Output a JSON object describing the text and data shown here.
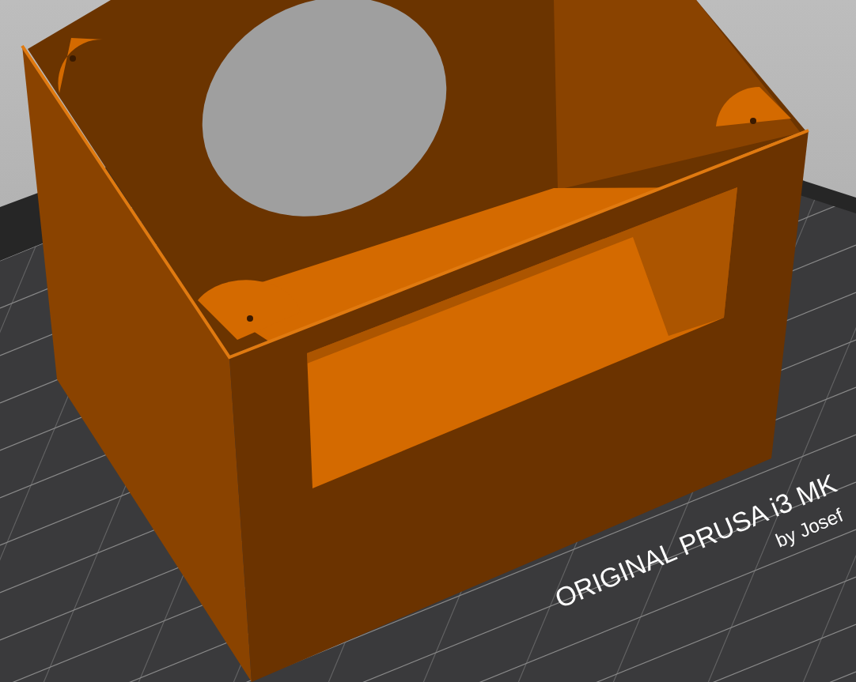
{
  "bed_label": {
    "title": "ORIGINAL PRUSA i3 MK",
    "subtitle": "by Josef"
  }
}
